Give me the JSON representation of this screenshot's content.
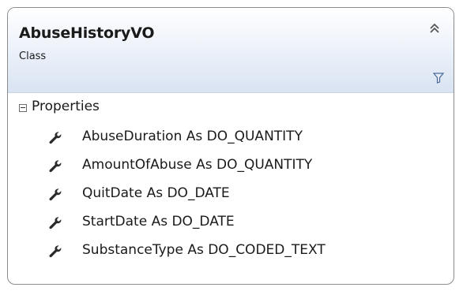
{
  "class": {
    "name": "AbuseHistoryVO",
    "stereotype": "Class"
  },
  "icons": {
    "collapse": "double-chevron-up-icon",
    "filter": "filter-icon",
    "property": "wrench-icon",
    "section_toggle": "minus-box-icon"
  },
  "colors": {
    "header_gradient_top": "#ffffff",
    "header_gradient_bottom": "#d9e3f2",
    "border": "#8c8c8c",
    "text": "#1a1a1a"
  },
  "section": {
    "label": "Properties",
    "items": [
      {
        "label": "AbuseDuration As DO_QUANTITY"
      },
      {
        "label": "AmountOfAbuse As DO_QUANTITY"
      },
      {
        "label": "QuitDate As DO_DATE"
      },
      {
        "label": "StartDate As DO_DATE"
      },
      {
        "label": "SubstanceType As DO_CODED_TEXT"
      }
    ]
  }
}
